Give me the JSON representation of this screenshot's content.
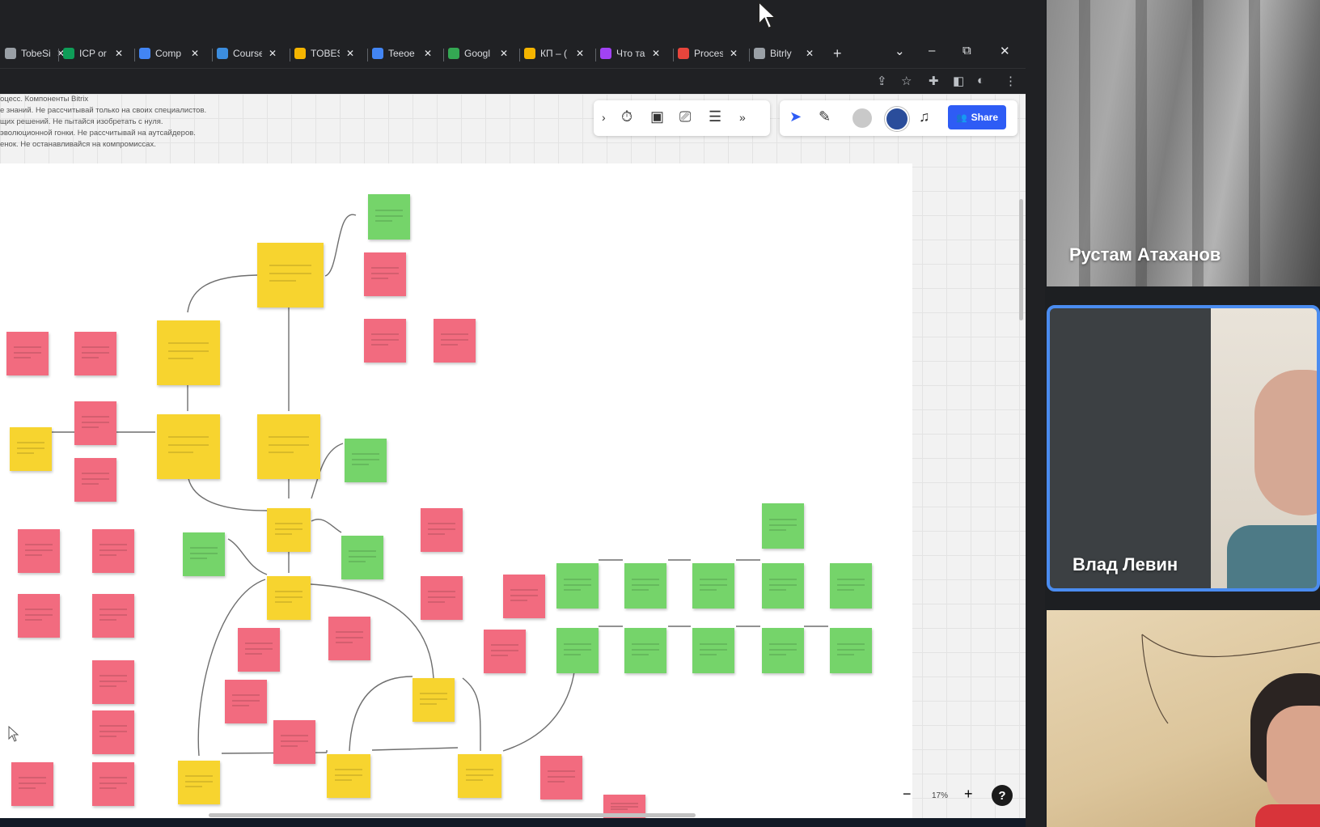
{
  "browser": {
    "tabs": [
      {
        "label": "TobeSi",
        "icon": "page-icon",
        "color": "#9aa0a6"
      },
      {
        "label": "ICP or",
        "icon": "sheets-icon",
        "color": "#0f9d58"
      },
      {
        "label": "Comp",
        "icon": "docs-icon",
        "color": "#4285f4"
      },
      {
        "label": "Course",
        "icon": "c-logo-icon",
        "color": "#3c8dde"
      },
      {
        "label": "TOBES",
        "icon": "drive-icon",
        "color": "#f4b400"
      },
      {
        "label": "Teeoe",
        "icon": "docs-icon",
        "color": "#4285f4"
      },
      {
        "label": "Googl",
        "icon": "google-icon",
        "color": "#34a853"
      },
      {
        "label": "КП – (",
        "icon": "drive-icon",
        "color": "#f4b400"
      },
      {
        "label": "Что та",
        "icon": "colorful-icon",
        "color": "#a142f4"
      },
      {
        "label": "Proces",
        "icon": "miro-icon",
        "color": "#e8453c"
      },
      {
        "label": "Bitrly",
        "icon": "globe-icon",
        "color": "#9aa0a6"
      }
    ],
    "new_tab": "+",
    "win_controls": {
      "chevron": "⌄",
      "minimize": "–",
      "restore": "⧉",
      "close": "✕"
    },
    "addr_icons": [
      "share-icon",
      "star-icon",
      "puzzle-icon",
      "sidepanel-icon",
      "profile-icon",
      "menu-icon"
    ]
  },
  "board": {
    "description": [
      "оцесс. Компоненты Bitrix",
      "е знаний. Не рассчитывай только на своих специалистов.",
      "щих решений. Не пытайся изобретать с нуля.",
      "эволюционной гонки. Не рассчитывай на аутсайдеров.",
      "енок. Не останавливайся на компромиссах."
    ],
    "share_label": "Share",
    "zoom": "17%",
    "zoom_minus": "−",
    "zoom_plus": "+",
    "help": "?",
    "note_colors": {
      "yellow": "#f7d42f",
      "pink": "#f26b7f",
      "green": "#75d46a"
    }
  },
  "participants": [
    {
      "name": "Рустам Атаханов",
      "speaking": false
    },
    {
      "name": "Влад Левин",
      "speaking": true
    },
    {
      "name": "",
      "speaking": false
    }
  ]
}
